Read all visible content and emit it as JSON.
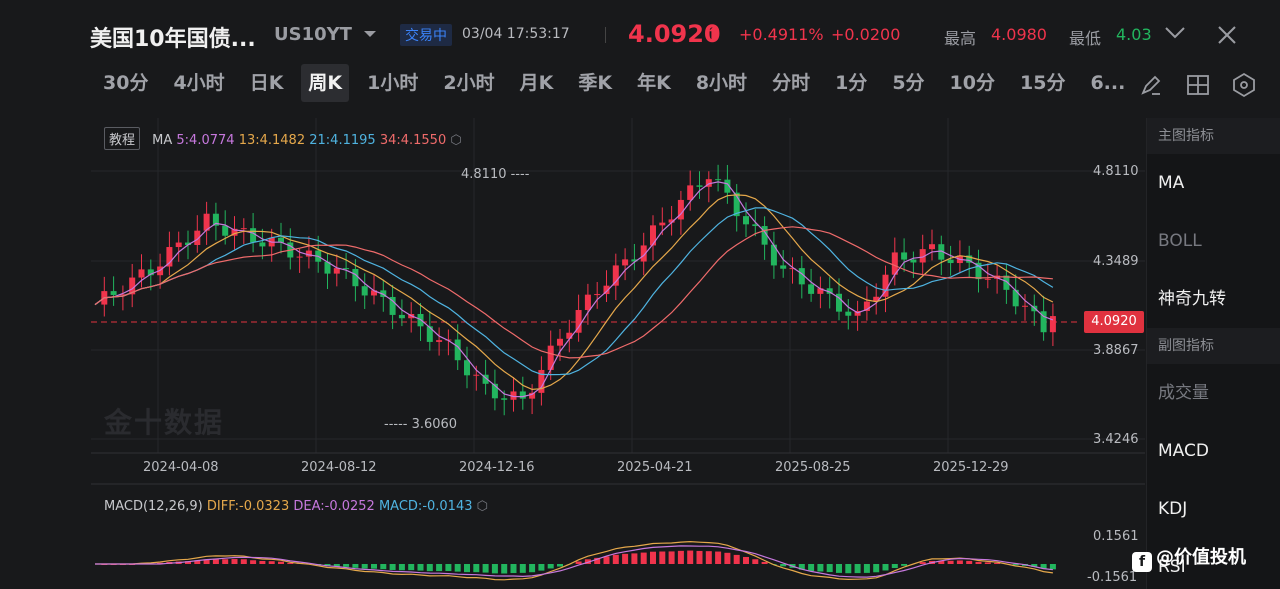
{
  "header": {
    "title": "美国10年国债...",
    "symbol": "US10YT",
    "status": "交易中",
    "timestamp": "03/04 17:53:17",
    "price": "4.0920",
    "change_pct": "+0.4911%",
    "change_val": "+0.0200",
    "high_label": "最高",
    "high_value": "4.0980",
    "low_label": "最低",
    "low_value": "4.03"
  },
  "tabs": [
    "30分",
    "4小时",
    "日K",
    "周K",
    "1小时",
    "2小时",
    "月K",
    "季K",
    "年K",
    "8小时",
    "分时",
    "1分",
    "5分",
    "10分",
    "15分",
    "6..."
  ],
  "active_tab": "周K",
  "ma_legend": {
    "tutorial": "教程",
    "label": "MA",
    "ma5": "5:4.0774",
    "ma13": "13:4.1482",
    "ma21": "21:4.1195",
    "ma34": "34:4.1550"
  },
  "macd_legend": {
    "label": "MACD(12,26,9)",
    "diff": "DIFF:-0.0323",
    "dea": "DEA:-0.0252",
    "macd": "MACD:-0.0143"
  },
  "watermark": "金十数据",
  "chart_data": {
    "type": "candlestick",
    "y_ticks": [
      "4.8110",
      "4.3489",
      "3.8867",
      "3.4246"
    ],
    "y_range": [
      3.4246,
      4.811
    ],
    "x_ticks": [
      "2024-04-08",
      "2024-08-12",
      "2024-12-16",
      "2025-04-21",
      "2025-08-25",
      "2025-12-29"
    ],
    "last_price": "4.0920",
    "annotations": {
      "high_label": "4.8110",
      "low_label": "3.6060"
    },
    "macd_ticks": [
      "0.1561",
      "-0.1561"
    ],
    "ma_colors": {
      "ma5": "#c678dd",
      "ma13": "#e5a84b",
      "ma21": "#4fb3e0",
      "ma34": "#ef6b6b"
    },
    "up_color": "#f0344c",
    "down_color": "#22b55e"
  },
  "right_panel": {
    "main_header": "主图指标",
    "main_items": [
      "MA",
      "BOLL",
      "神奇九转"
    ],
    "sub_header": "副图指标",
    "sub_items": [
      "成交量",
      "MACD",
      "KDJ",
      "RSI"
    ]
  },
  "badge": "@价值投机"
}
